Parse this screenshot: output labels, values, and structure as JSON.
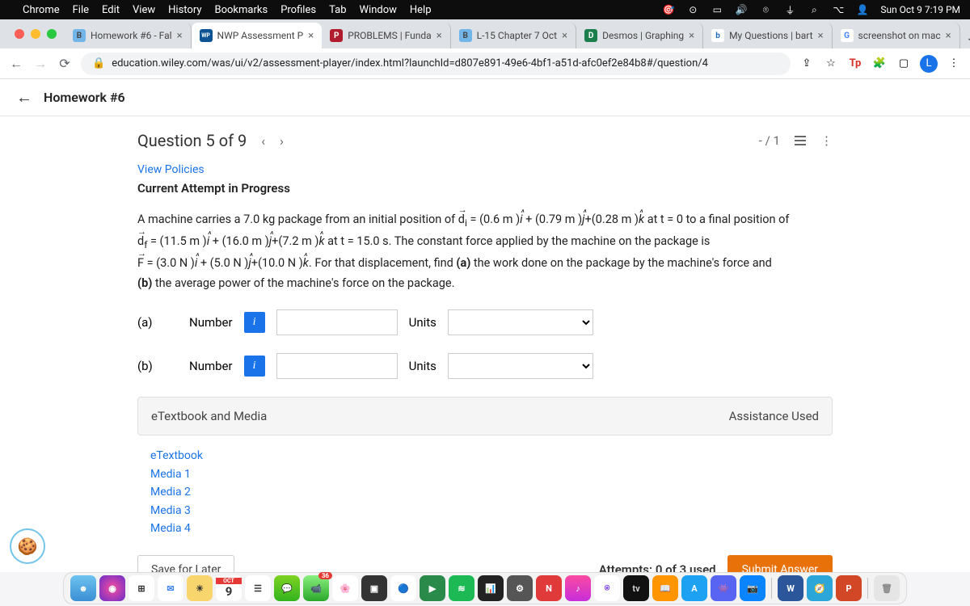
{
  "menubar": {
    "apple": "",
    "app": "Chrome",
    "items": [
      "File",
      "Edit",
      "View",
      "History",
      "Bookmarks",
      "Profiles",
      "Tab",
      "Window",
      "Help"
    ],
    "clock": "Sun Oct 9 7:19 PM"
  },
  "tabs": [
    {
      "favicon_bg": "#72b5e8",
      "favicon_txt": "B",
      "title": "Homework #6 - Fal"
    },
    {
      "favicon_bg": "#0b5394",
      "favicon_txt": "WP",
      "title": "NWP Assessment P",
      "active": true
    },
    {
      "favicon_bg": "#b01c2e",
      "favicon_txt": "P",
      "title": "PROBLEMS | Funda"
    },
    {
      "favicon_bg": "#72b5e8",
      "favicon_txt": "B",
      "title": "L-15 Chapter 7 Oct"
    },
    {
      "favicon_bg": "#1b7f4d",
      "favicon_txt": "D",
      "title": "Desmos | Graphing"
    },
    {
      "favicon_bg": "#fff",
      "favicon_txt": "b",
      "favicon_color": "#1e6db5",
      "title": "My Questions | bart"
    },
    {
      "favicon_bg": "#fff",
      "favicon_txt": "G",
      "favicon_color": "#4285f4",
      "title": "screenshot on mac"
    }
  ],
  "addr": {
    "lock": "🔒",
    "url": "education.wiley.com/was/ui/v2/assessment-player/index.html?launchId=d807e891-49e6-4bf1-a51d-afc0ef2e84b8#/question/4"
  },
  "hw": {
    "back_arrow": "←",
    "title": "Homework #6"
  },
  "question": {
    "title": "Question 5 of 9",
    "prev": "‹",
    "next": "›",
    "score": "- / 1",
    "policies": "View Policies",
    "attempt": "Current Attempt in Progress"
  },
  "problem": {
    "text1": "A machine carries a 7.0 kg package from an initial position of ",
    "d_i": "d",
    "sub_i": "i",
    "eq1": " = (0.6 m )",
    "ihat": "i",
    "plus1": " + (0.79 m )",
    "jhat": "j",
    "plus2": "+(0.28 m )",
    "khat": "k",
    "text2": " at t = 0 to a final position of ",
    "d_f": "d",
    "sub_f": "f",
    "eq2": " = (11.5 m )",
    "plus3": " + (16.0 m )",
    "plus4": "+(7.2 m )",
    "text3": " at t = 15.0 s. The constant force applied by the machine on the package is ",
    "F": "F",
    "eq3": " = (3.0 N )",
    "plus5": " + (5.0 N )",
    "plus6": "+(10.0 N )",
    "text4": ". For that displacement, find ",
    "bold_a": "(a)",
    "text5": " the work done on the package by the machine's force and ",
    "bold_b": "(b)",
    "text6": " the average power of the machine's force on the package."
  },
  "answers": {
    "a_label": "(a)",
    "b_label": "(b)",
    "number": "Number",
    "units": "Units",
    "info": "i"
  },
  "etextbook": {
    "header": "eTextbook and Media",
    "assist": "Assistance Used",
    "links": [
      "eTextbook",
      "Media 1",
      "Media 2",
      "Media 3",
      "Media 4"
    ]
  },
  "footer": {
    "save": "Save for Later",
    "attempts": "Attempts: 0 of 3 used",
    "submit": "Submit Answer"
  },
  "dock": {
    "cal_month": "OCT",
    "cal_day": "9",
    "tv": "tv",
    "W": "W",
    "P": "P"
  }
}
